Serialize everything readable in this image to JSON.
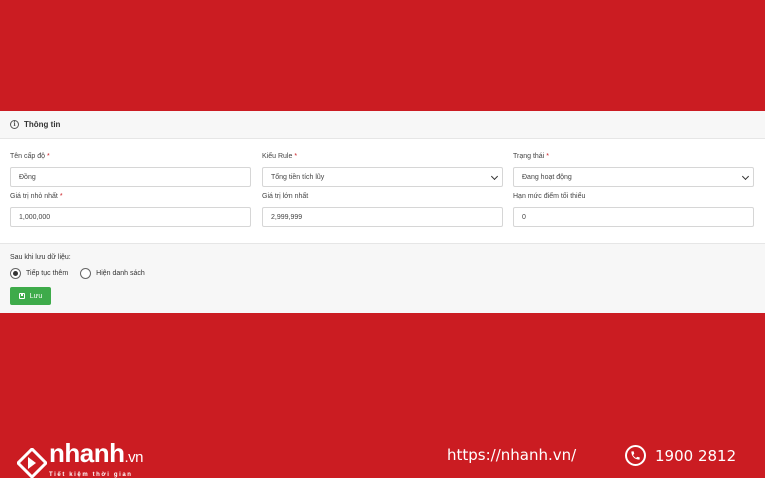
{
  "panel": {
    "title": "Thông tin"
  },
  "form": {
    "level_name": {
      "label": "Tên cấp độ",
      "required": "*",
      "value": "Đồng"
    },
    "rule_type": {
      "label": "Kiểu Rule",
      "required": "*",
      "value": "Tổng tiền tích lũy"
    },
    "status": {
      "label": "Trạng thái",
      "required": "*",
      "value": "Đang hoạt động"
    },
    "min_value": {
      "label": "Giá trị nhỏ nhất",
      "required": "*",
      "value": "1,000,000"
    },
    "max_value": {
      "label": "Giá trị lớn nhất",
      "value": "2,999,999"
    },
    "min_points": {
      "label": "Hạn mức điểm tối thiểu",
      "value": "0"
    }
  },
  "after_save": {
    "label": "Sau khi lưu dữ liệu:",
    "options": [
      {
        "label": "Tiếp tục thêm",
        "selected": true
      },
      {
        "label": "Hiện danh sách",
        "selected": false
      }
    ],
    "save_label": "Lưu"
  },
  "branding": {
    "logo_main": "nhanh",
    "logo_suffix": ".vn",
    "tagline": "Tiết kiệm thời gian",
    "website": "https://nhanh.vn/",
    "phone": "1900 2812"
  },
  "colors": {
    "background": "#cb1c22",
    "save_button": "#3eab4a"
  }
}
